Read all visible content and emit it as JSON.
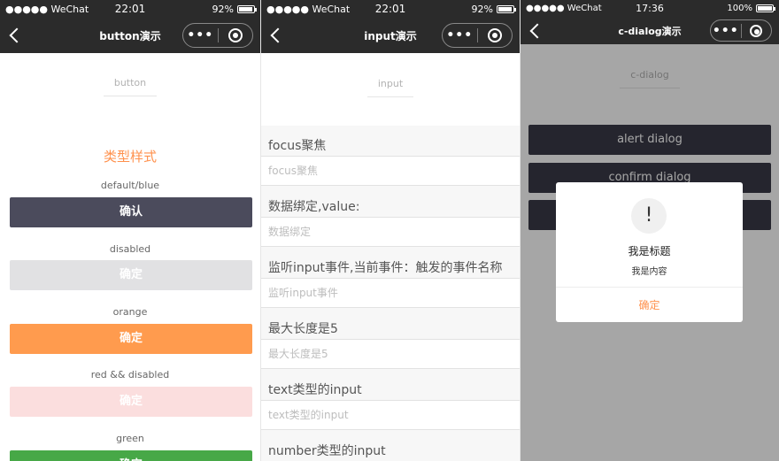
{
  "colors": {
    "bar": "#2b2b2b",
    "accent": "#ff914d",
    "default_btn": "#4b4b5c",
    "disabled_btn": "#e1e1e3",
    "orange_btn": "#ff9b4e",
    "red_disabled_btn": "#fbdede",
    "green_btn": "#47a847",
    "dialog_btn": "#3a3a47"
  },
  "phone1": {
    "status": {
      "carrier": "●●●●● WeChat",
      "time": "22:01",
      "battery": "92%",
      "battery_level": 0.92
    },
    "nav": {
      "title": "button演示",
      "more": "•••"
    },
    "demo_title": "button",
    "section": "类型样式",
    "items": [
      {
        "label": "default/blue",
        "button": "确认"
      },
      {
        "label": "disabled",
        "button": "确定"
      },
      {
        "label": "orange",
        "button": "确定"
      },
      {
        "label": "red && disabled",
        "button": "确定"
      },
      {
        "label": "green",
        "button": "确定"
      }
    ]
  },
  "phone2": {
    "status": {
      "carrier": "●●●●● WeChat",
      "time": "22:01",
      "battery": "92%",
      "battery_level": 0.92
    },
    "nav": {
      "title": "input演示",
      "more": "•••"
    },
    "demo_title": "input",
    "fields": [
      {
        "label": "focus聚焦",
        "placeholder": "focus聚焦"
      },
      {
        "label": "数据绑定,value:",
        "placeholder": "数据绑定"
      },
      {
        "label": "监听input事件,当前事件：触发的事件名称",
        "placeholder": "监听input事件"
      },
      {
        "label": "最大长度是5",
        "placeholder": "最大长度是5"
      },
      {
        "label": "text类型的input",
        "placeholder": "text类型的input"
      },
      {
        "label": "number类型的input",
        "placeholder": ""
      }
    ]
  },
  "phone3": {
    "status": {
      "carrier": "●●●●● WeChat",
      "time": "17:36",
      "battery": "100%",
      "battery_level": 1.0
    },
    "nav": {
      "title": "c-dialog演示",
      "more": "•••"
    },
    "demo_title": "c-dialog",
    "buttons": [
      "alert dialog",
      "confirm dialog",
      ""
    ],
    "dialog": {
      "icon": "!",
      "title": "我是标题",
      "content": "我是内容",
      "confirm": "确定"
    }
  }
}
